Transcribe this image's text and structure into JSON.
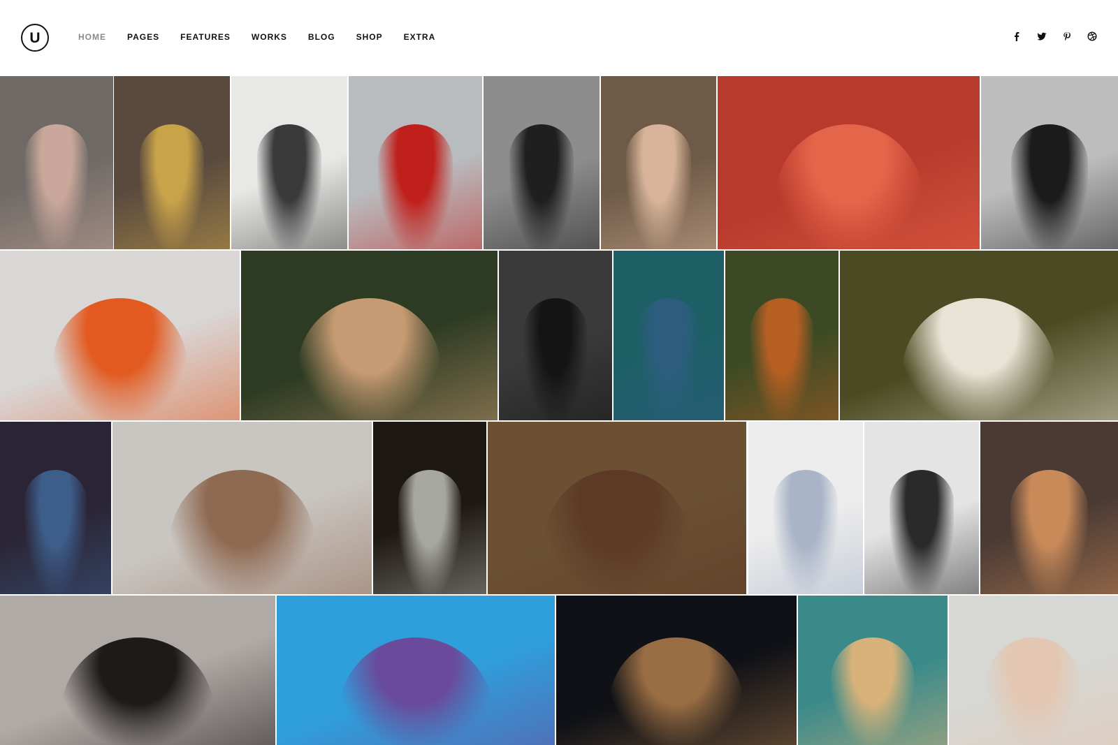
{
  "logo": {
    "letter": "U"
  },
  "nav": {
    "items": [
      {
        "label": "HOME",
        "active": true
      },
      {
        "label": "PAGES",
        "active": false
      },
      {
        "label": "FEATURES",
        "active": false
      },
      {
        "label": "WORKS",
        "active": false
      },
      {
        "label": "BLOG",
        "active": false
      },
      {
        "label": "SHOP",
        "active": false
      },
      {
        "label": "EXTRA",
        "active": false
      }
    ]
  },
  "social": [
    "facebook-icon",
    "twitter-icon",
    "pinterest-icon",
    "dribbble-icon"
  ],
  "gallery": {
    "rows": [
      [
        {
          "name": "photo-woman-bedroom",
          "bg": "#6f6a66",
          "fg": "#c9a79a"
        },
        {
          "name": "photo-boy-headphones",
          "bg": "#5a4a3e",
          "fg": "#c9a34a"
        },
        {
          "name": "photo-man-hallway",
          "bg": "#e8e8e6",
          "fg": "#3a3a3a"
        },
        {
          "name": "photo-woman-red-jacket",
          "bg": "#b9bcbf",
          "fg": "#c0201c"
        },
        {
          "name": "photo-woman-bw",
          "bg": "#8d8d8d",
          "fg": "#1f1f1f"
        },
        {
          "name": "photo-girl-striped",
          "bg": "#6e5a46",
          "fg": "#d7b39a"
        },
        {
          "name": "photo-flamingo",
          "bg": "#b83a2c",
          "fg": "#e4664a"
        },
        {
          "name": "photo-man-sitting",
          "bg": "#bdbdbd",
          "fg": "#1b1b1b"
        }
      ],
      [
        {
          "name": "photo-redhead-woman",
          "bg": "#d9d6d6",
          "fg": "#e25a20"
        },
        {
          "name": "photo-woman-leaves",
          "bg": "#2d3b22",
          "fg": "#c69a72"
        },
        {
          "name": "photo-man-sunglasses-bw",
          "bg": "#3a3a3a",
          "fg": "#141414"
        },
        {
          "name": "photo-man-dreadlocks",
          "bg": "#1e5f66",
          "fg": "#2c5d7e"
        },
        {
          "name": "photo-squirrel",
          "bg": "#3b4a24",
          "fg": "#b65f23"
        },
        {
          "name": "photo-girl-hood",
          "bg": "#4c4a22",
          "fg": "#e8e3d4"
        }
      ],
      [
        {
          "name": "photo-couple-night",
          "bg": "#2a2434",
          "fg": "#3d5d8a"
        },
        {
          "name": "photo-man-profile",
          "bg": "#c9c5c1",
          "fg": "#8f6a52"
        },
        {
          "name": "photo-old-man",
          "bg": "#1e1812",
          "fg": "#a7a7a2"
        },
        {
          "name": "photo-woman-grass",
          "bg": "#6b5034",
          "fg": "#5c3a26"
        },
        {
          "name": "photo-man-blazer",
          "bg": "#ececec",
          "fg": "#a9b4c8"
        },
        {
          "name": "photo-man-portrait-bw",
          "bg": "#e4e4e4",
          "fg": "#2a2a2a"
        },
        {
          "name": "photo-woman-lilac-hair",
          "bg": "#4b3a33",
          "fg": "#c98a5a"
        }
      ],
      [
        {
          "name": "photo-asian-woman",
          "bg": "#b0aaa6",
          "fg": "#1e1a1a"
        },
        {
          "name": "photo-woman-headscarf",
          "bg": "#2f9fdc",
          "fg": "#6a4a9a"
        },
        {
          "name": "photo-dog",
          "bg": "#0f1116",
          "fg": "#9a6e44"
        },
        {
          "name": "photo-woman-water",
          "bg": "#3a8a8a",
          "fg": "#d8b27a"
        },
        {
          "name": "photo-woman-silver-hair",
          "bg": "#d7d7d3",
          "fg": "#e3c7b2"
        }
      ]
    ]
  }
}
